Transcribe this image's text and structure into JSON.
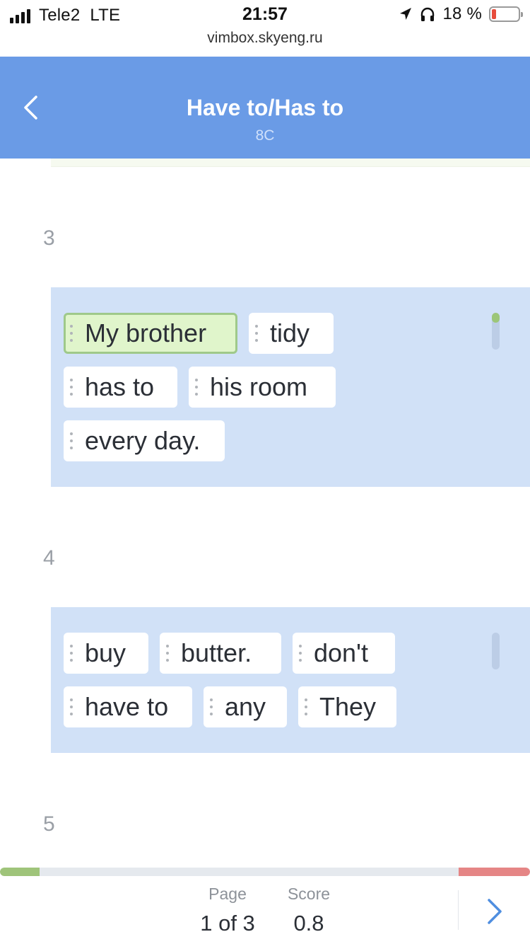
{
  "status_bar": {
    "carrier": "Tele2",
    "network": "LTE",
    "time": "21:57",
    "battery_percent": "18 %",
    "battery_level": 0.18,
    "icons": [
      "signal-icon",
      "location-arrow-icon",
      "headphones-icon",
      "battery-icon"
    ]
  },
  "browser": {
    "url": "vimbox.skyeng.ru"
  },
  "header": {
    "title": "Have to/Has to",
    "subtitle": "8C",
    "back_icon": "chevron-left-icon",
    "background_color": "#6a9be6"
  },
  "exercises": [
    {
      "number": "3",
      "words": [
        "My brother",
        "tidy",
        "has to",
        "his room",
        "every day."
      ],
      "selected_word": "My brother"
    },
    {
      "number": "4",
      "words": [
        "buy",
        "butter.",
        "don't",
        "have to",
        "any",
        "They"
      ]
    },
    {
      "number": "5"
    }
  ],
  "footer": {
    "page_label": "Page",
    "page_value": "1 of 3",
    "score_label": "Score",
    "score_value": "0.8",
    "next_icon": "chevron-right-icon"
  },
  "colors": {
    "accent": "#6a9be6",
    "card_background": "#d1e1f7",
    "selected_chip": "#e0f5cb",
    "progress_done": "#9fc47a",
    "progress_error": "#e58585"
  }
}
